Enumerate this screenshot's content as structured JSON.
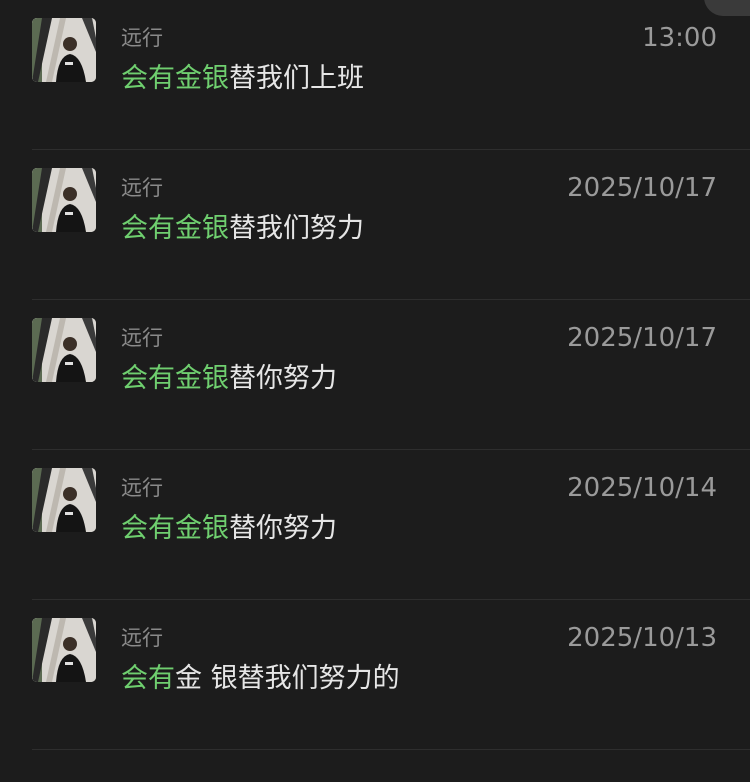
{
  "results": [
    {
      "sender": "远行",
      "time": "13:00",
      "highlight": "会有金银",
      "mid": "",
      "rest": "替我们上班"
    },
    {
      "sender": "远行",
      "time": "2025/10/17",
      "highlight": "会有金银",
      "mid": "",
      "rest": "替我们努力"
    },
    {
      "sender": "远行",
      "time": "2025/10/17",
      "highlight": "会有金银",
      "mid": "",
      "rest": "替你努力"
    },
    {
      "sender": "远行",
      "time": "2025/10/14",
      "highlight": "会有金银",
      "mid": "",
      "rest": "替你努力"
    },
    {
      "sender": "远行",
      "time": "2025/10/13",
      "highlight": "会有",
      "mid": "金 ",
      "rest": "银替我们努力的"
    }
  ],
  "colors": {
    "highlight": "#6fcf6f",
    "background": "#1c1c1c"
  }
}
